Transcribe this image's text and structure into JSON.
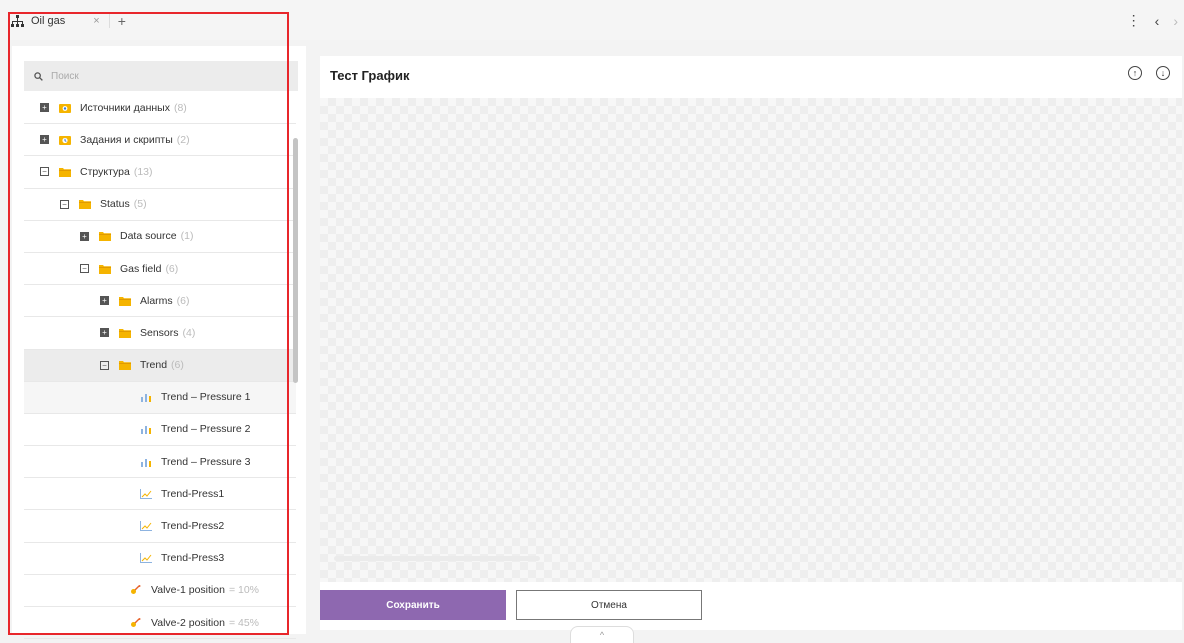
{
  "tabs": [
    {
      "label": "Oil gas",
      "close": "×"
    }
  ],
  "tab_add": "+",
  "top_actions": {
    "menu": "⋮",
    "back": "‹",
    "forward": "›"
  },
  "search": {
    "placeholder": "Поиск"
  },
  "tree": [
    {
      "label": "Источники данных",
      "count": "(8)",
      "depth": 0,
      "toggle": "plus",
      "icon": "datasource-icon"
    },
    {
      "label": "Задания и скрипты",
      "count": "(2)",
      "depth": 0,
      "toggle": "plus",
      "icon": "script-icon"
    },
    {
      "label": "Структура",
      "count": "(13)",
      "depth": 0,
      "toggle": "minus",
      "icon": "folder-icon"
    },
    {
      "label": "Status",
      "count": "(5)",
      "depth": 1,
      "toggle": "minus",
      "icon": "folder-icon"
    },
    {
      "label": "Data source",
      "count": "(1)",
      "depth": 2,
      "toggle": "plus",
      "icon": "folder-icon"
    },
    {
      "label": "Gas field",
      "count": "(6)",
      "depth": 2,
      "toggle": "minus",
      "icon": "folder-icon"
    },
    {
      "label": "Alarms",
      "count": "(6)",
      "depth": 3,
      "toggle": "plus",
      "icon": "folder-icon"
    },
    {
      "label": "Sensors",
      "count": "(4)",
      "depth": 3,
      "toggle": "plus",
      "icon": "folder-icon"
    },
    {
      "label": "Trend",
      "count": "(6)",
      "depth": 3,
      "toggle": "minus",
      "icon": "folder-icon",
      "selected": true
    },
    {
      "label": "Trend – Pressure 1",
      "count": "",
      "depth": 5,
      "toggle": "none",
      "icon": "chart-bars-icon",
      "hovered": true
    },
    {
      "label": "Trend – Pressure 2",
      "count": "",
      "depth": 5,
      "toggle": "none",
      "icon": "chart-bars-icon"
    },
    {
      "label": "Trend – Pressure 3",
      "count": "",
      "depth": 5,
      "toggle": "none",
      "icon": "chart-bars-icon"
    },
    {
      "label": "Trend-Press1",
      "count": "",
      "depth": 5,
      "toggle": "none",
      "icon": "chart-line-icon"
    },
    {
      "label": "Trend-Press2",
      "count": "",
      "depth": 5,
      "toggle": "none",
      "icon": "chart-line-icon"
    },
    {
      "label": "Trend-Press3",
      "count": "",
      "depth": 5,
      "toggle": "none",
      "icon": "chart-line-icon"
    },
    {
      "label": "Valve-1 position",
      "count": "= 10%",
      "depth": 4.5,
      "toggle": "none",
      "icon": "valve-icon"
    },
    {
      "label": "Valve-2 position",
      "count": "= 45%",
      "depth": 4.5,
      "toggle": "none",
      "icon": "valve-icon"
    }
  ],
  "panel": {
    "title": "Тест График"
  },
  "buttons": {
    "save": "Сохранить",
    "cancel": "Отмена"
  },
  "bottom_handle": "^",
  "colors": {
    "accent": "#8e68b0",
    "folder": "#f5b400",
    "highlight": "#e8262b"
  }
}
